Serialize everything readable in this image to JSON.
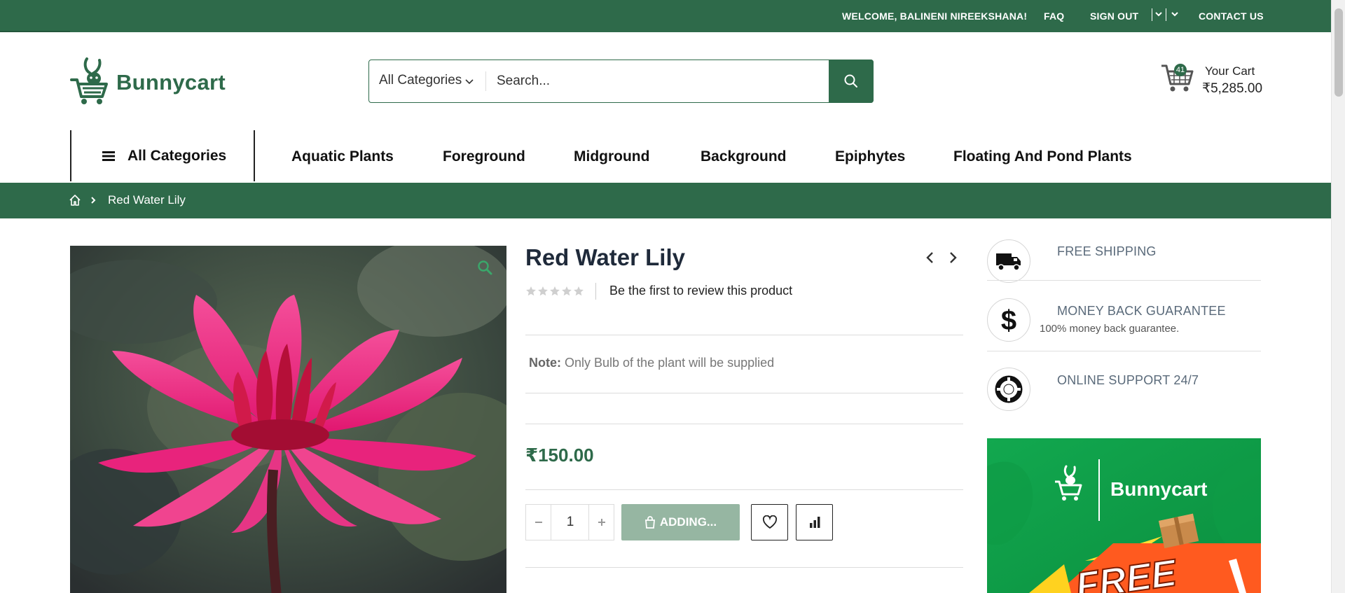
{
  "topbar": {
    "welcome": "WELCOME, BALINENI NIREEKSHANA!",
    "faq": "FAQ",
    "sign_out": "SIGN OUT",
    "contact": "CONTACT US"
  },
  "header": {
    "logo_text": "Bunnycart",
    "search": {
      "category": "All Categories",
      "placeholder": "Search..."
    },
    "cart": {
      "count": "41",
      "label": "Your Cart",
      "total": "₹5,285.00"
    }
  },
  "nav": {
    "all_categories": "All Categories",
    "items": [
      "Aquatic Plants",
      "Foreground",
      "Midground",
      "Background",
      "Epiphytes",
      "Floating And Pond Plants"
    ]
  },
  "breadcrumb": {
    "current": "Red Water Lily"
  },
  "product": {
    "title": "Red Water Lily",
    "rating": 0,
    "review_text": "Be the first to review this product",
    "note_label": "Note:",
    "note_text": " Only Bulb of the plant will be supplied",
    "price": "₹150.00",
    "quantity": "1",
    "add_button": "ADDING..."
  },
  "features": [
    {
      "title": "FREE SHIPPING",
      "subtitle": ""
    },
    {
      "title": "MONEY BACK GUARANTEE",
      "subtitle": "100% money back guarantee."
    },
    {
      "title": "ONLINE SUPPORT 24/7",
      "subtitle": ""
    }
  ],
  "promo": {
    "logo_text": "Bunnycart",
    "banner_text": "FREE"
  },
  "colors": {
    "brand_green": "#2e6a4a",
    "add_button_disabled": "#96b6a2",
    "promo_green": "#1aa653"
  }
}
